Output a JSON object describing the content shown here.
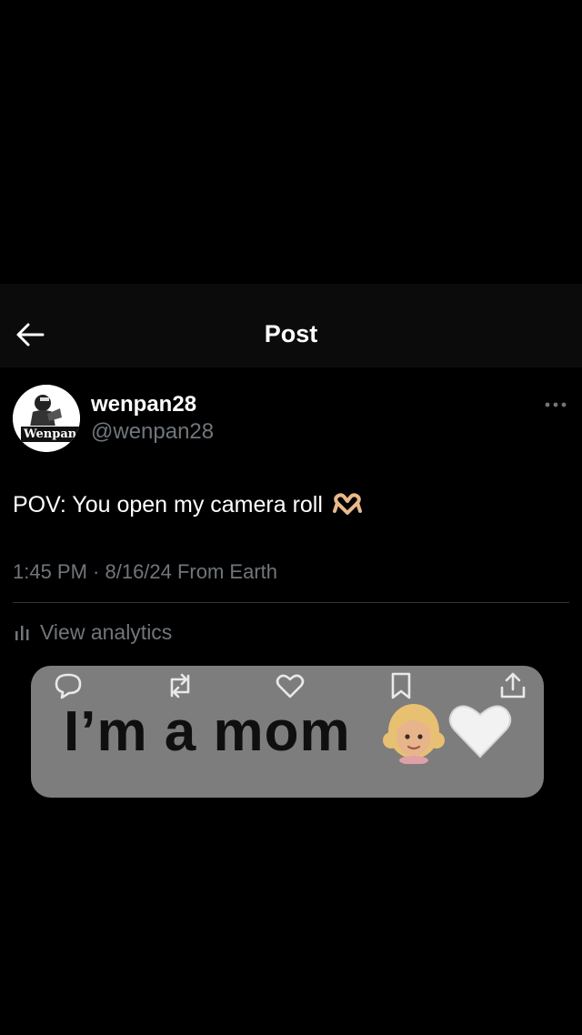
{
  "header": {
    "title": "Post"
  },
  "post": {
    "display_name": "wenpan28",
    "handle": "@wenpan28",
    "avatar_text": "Wenpan",
    "text": "POV: You open my camera roll",
    "meta": "1:45 PM · 8/16/24 From Earth",
    "analytics_label": "View analytics"
  },
  "overlay": {
    "caption": "I’m a mom"
  },
  "icons": {
    "back": "arrow-left-icon",
    "more": "more-horizontal-icon",
    "analytics": "bar-chart-icon",
    "reply": "reply-icon",
    "repost": "repost-icon",
    "like": "heart-icon",
    "bookmark": "bookmark-icon",
    "share": "share-icon"
  },
  "colors": {
    "background": "#000000",
    "muted": "#71767b",
    "overlay": "#7d7d7d"
  }
}
